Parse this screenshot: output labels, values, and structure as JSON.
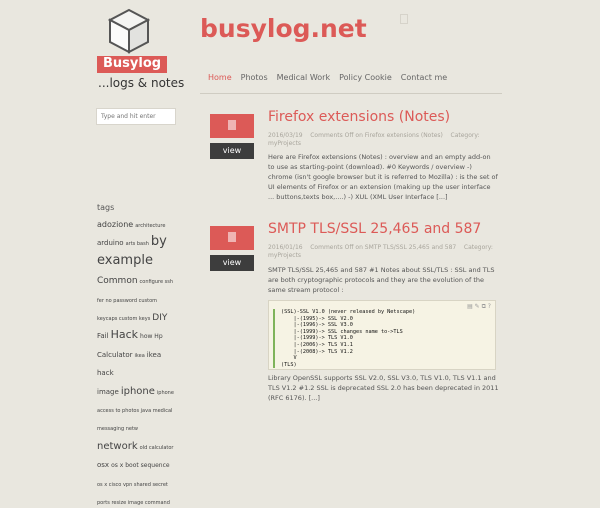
{
  "site": {
    "badge": "Busylog",
    "tagline": "...logs & notes",
    "title": "busylog.net"
  },
  "nav": {
    "items": [
      "Home",
      "Photos",
      "Medical Work",
      "Policy Cookie",
      "Contact me"
    ],
    "active": "Home"
  },
  "search": {
    "placeholder": "Type and hit enter"
  },
  "tags": {
    "title": "tags",
    "line1": "adozione",
    "line1b": "architecture",
    "line2": "arduino",
    "line2b": "arts bash",
    "line2c": "by",
    "line3": "example",
    "line4": "Common",
    "line4b": "configure ssh",
    "line5": "fer no password custom",
    "line6": "keycaps custom keys",
    "line6b": "DIY",
    "line7": "Fail",
    "line7b": "Hack",
    "line7c": "how Hp",
    "line8": "Calculator",
    "line8b": "ikea",
    "line8c": "ikea hack",
    "line9": "image",
    "line9b": "iphone",
    "line9c": "iphone",
    "line10": "access to photos java medical",
    "line11": "messaging netw",
    "line12": "network",
    "line12b": "old calculator",
    "line13": "osx",
    "line13b": "os x boot sequence",
    "line14": "os x cisco vpn shared secret",
    "line15": "ports resize image command"
  },
  "posts": [
    {
      "title": "Firefox extensions (Notes)",
      "date": "2016/03/19",
      "comments": "Comments Off on Firefox extensions (Notes)",
      "category": "Category:",
      "category_value": "myProjects",
      "excerpt": "Here are Firefox extensions (Notes) : overview and an empty add-on to use as starting-point (download). #0 Keywords / overview -) chrome (isn't google browser but it is referred to Mozilla) : is the set of UI elements of Firefox or an extension (making up the user interface ... buttons,texts box,....) -) XUL (XML User Interface [...]",
      "view_label": "view"
    },
    {
      "title": "SMTP TLS/SSL 25,465 and 587",
      "date": "2016/01/16",
      "comments": "Comments Off on SMTP TLS/SSL 25,465 and 587",
      "category": "Category:",
      "category_value": "myProjects",
      "excerpt": "SMTP TLS/SSL 25,465 and 587 #1 Notes about SSL/TLS : SSL and TLS are both cryptographic protocols and they are the evolution of the same stream protocol :",
      "view_label": "view",
      "code": "(SSL)-SSL V1.0 (never released by Netscape)\n    |-(1995)-> SSL V2.0\n    |-(1996)-> SSL V3.0\n    |-(1999)-> SSL changes name to->TLS\n    |-(1999)-> TLS V1.0\n    |-(2006)-> TLS V1.1\n    |-(2008)-> TLS V1.2\n    V\n(TLS)",
      "after": "Library OpenSSL supports SSL V2.0, SSL V3.0, TLS V1.0, TLS V1.1 and TLS V1.2 #1.2 SSL is deprecated SSL 2.0 has been deprecated in 2011 (RFC 6176). [...]"
    }
  ],
  "colors": {
    "accent": "#dc5a57",
    "background": "#e9e7df",
    "button": "#3d3d3d"
  },
  "icons": {
    "logo": "cube-icon",
    "thumb": "document-icon"
  }
}
